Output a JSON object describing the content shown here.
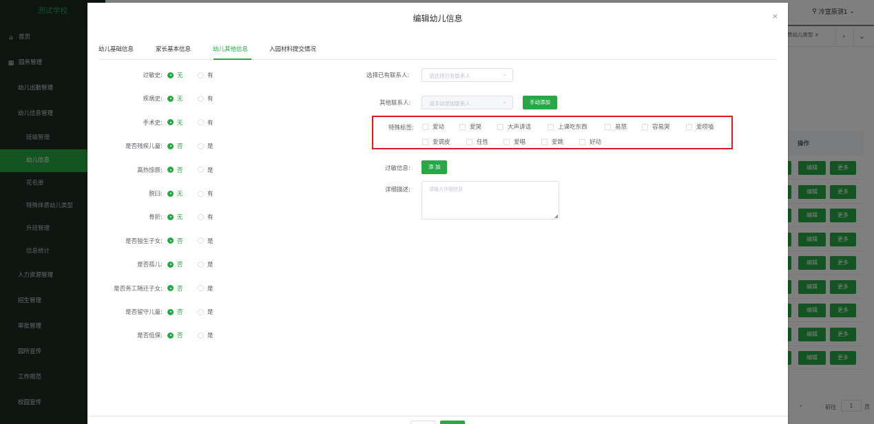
{
  "sidebar": {
    "brand": "测试学校",
    "items": [
      {
        "label": "首页",
        "icon": "home-icon",
        "level": "top"
      },
      {
        "label": "园务管理",
        "icon": "building-icon",
        "level": "top"
      },
      {
        "label": "幼儿出勤管理",
        "level": "sub1"
      },
      {
        "label": "幼儿信息管理",
        "level": "sub1"
      },
      {
        "label": "班级管理",
        "level": "sub2"
      },
      {
        "label": "幼儿信息",
        "level": "sub2",
        "active": true
      },
      {
        "label": "花名册",
        "level": "sub2"
      },
      {
        "label": "特殊体质幼儿类型",
        "level": "sub2"
      },
      {
        "label": "升班管理",
        "level": "sub2"
      },
      {
        "label": "信息统计",
        "level": "sub2"
      },
      {
        "label": "人力资源管理",
        "level": "sub1"
      },
      {
        "label": "招生管理",
        "level": "sub1"
      },
      {
        "label": "审批管理",
        "level": "sub1"
      },
      {
        "label": "园所宣传",
        "level": "sub1"
      },
      {
        "label": "工作规范",
        "level": "sub1"
      },
      {
        "label": "校园宣传",
        "level": "sub1"
      }
    ]
  },
  "topbar": {
    "user": "冷宣原测1"
  },
  "bg_tabs": {
    "tab": "质幼儿类型 ×"
  },
  "bg_table": {
    "header": "操作",
    "edit_label": "编辑",
    "more_label": "更多"
  },
  "pager": {
    "goto": "前往",
    "page": "1",
    "suffix": "页"
  },
  "dialog": {
    "title": "编辑幼儿信息",
    "close": "×",
    "tabs": [
      "幼儿基础信息",
      "家长基本信息",
      "幼儿其他信息",
      "入园材料提交情况"
    ],
    "left_fields": [
      {
        "label": "过敏史:",
        "opt1": "无",
        "opt2": "有"
      },
      {
        "label": "疾病史:",
        "opt1": "无",
        "opt2": "有"
      },
      {
        "label": "手术史:",
        "opt1": "无",
        "opt2": "有"
      },
      {
        "label": "是否残疾儿童:",
        "opt1": "否",
        "opt2": "是"
      },
      {
        "label": "高热惊厥:",
        "opt1": "否",
        "opt2": "是"
      },
      {
        "label": "脱臼:",
        "opt1": "无",
        "opt2": "有"
      },
      {
        "label": "骨折:",
        "opt1": "无",
        "opt2": "有"
      },
      {
        "label": "是否独生子女:",
        "opt1": "否",
        "opt2": "是"
      },
      {
        "label": "是否孤儿:",
        "opt1": "否",
        "opt2": "是"
      },
      {
        "label": "是否务工随迁子女:",
        "opt1": "否",
        "opt2": "是"
      },
      {
        "label": "是否留守儿童:",
        "opt1": "否",
        "opt2": "是"
      },
      {
        "label": "是否低保:",
        "opt1": "否",
        "opt2": "是"
      }
    ],
    "right": {
      "contact_label": "选择已有联系人:",
      "contact_placeholder": "请选择已有联系人",
      "other_label": "其他联系人:",
      "other_placeholder": "请手动添加联系人",
      "manual_add": "手动添加",
      "tags_label": "特殊标签:",
      "tags_row1": [
        "爱动",
        "爱哭",
        "大声讲话",
        "上课吃东西",
        "易怒",
        "容易哭",
        "爱唠嗑"
      ],
      "tags_row2": [
        "爱调皮",
        "任性",
        "爱唱",
        "爱跳",
        "好动"
      ],
      "allergy_label": "过敏信息:",
      "allergy_add": "添 加",
      "detail_label": "详细描述:",
      "detail_placeholder": "请输入详细信息"
    }
  }
}
